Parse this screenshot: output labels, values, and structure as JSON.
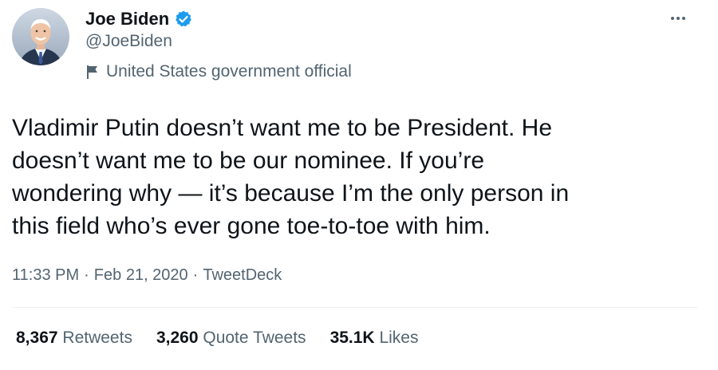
{
  "author": {
    "display_name": "Joe Biden",
    "handle": "@JoeBiden",
    "verified": true,
    "label": "United States government official"
  },
  "tweet": {
    "text": "Vladimir Putin doesn’t want me to be President. He\ndoesn’t want me to be our nominee. If you’re\nwondering why — it’s because I’m the only person in\nthis field who’s ever gone toe-to-toe with him.",
    "time": "11:33 PM",
    "date": "Feb 21, 2020",
    "source": "TweetDeck",
    "separator": "·"
  },
  "stats": {
    "retweets_count": "8,367",
    "retweets_label": "Retweets",
    "quotes_count": "3,260",
    "quotes_label": "Quote Tweets",
    "likes_count": "35.1K",
    "likes_label": "Likes"
  },
  "colors": {
    "verified": "#1d9bf0",
    "text": "#0f1419",
    "secondary": "#536471",
    "divider": "#eff3f4"
  },
  "icons": {
    "verified": "verified-badge-icon",
    "label_flag": "flag-icon",
    "more": "more-horizontal-icon"
  }
}
